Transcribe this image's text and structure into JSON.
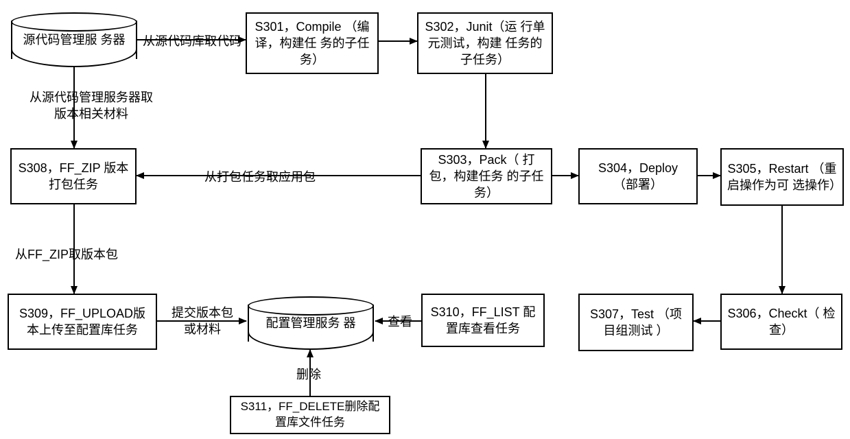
{
  "nodes": {
    "db_source": {
      "label": "源代码管理服\n务器"
    },
    "s301": {
      "label": "S301，Compile\n（编译，构建任\n务的子任务）"
    },
    "s302": {
      "label": "S302，Junit（运\n行单元测试，构建\n任务的子任务）"
    },
    "s303": {
      "label": "S303，Pack（\n打包，构建任务\n的子任务）"
    },
    "s304": {
      "label": "S304，Deploy\n（部署）"
    },
    "s305": {
      "label": "S305，Restart\n（重启操作为可\n选操作）"
    },
    "s306": {
      "label": "S306，Checkt（\n检查）"
    },
    "s307": {
      "label": "S307，Test\n（项目组测试\n）"
    },
    "s308": {
      "label": "S308，FF_ZIP\n版本打包任务"
    },
    "s309": {
      "label": "S309，FF_UPLOAD版\n本上传至配置库任务"
    },
    "s310": {
      "label": "S310，FF_LIST\n配置库查看任务"
    },
    "s311": {
      "label": "S311，FF_DELETE删除配\n置库文件任务"
    },
    "db_config": {
      "label": "配置管理服务\n器"
    }
  },
  "edgeLabels": {
    "l_getcode": "从源代码库取代码",
    "l_getmat": "从源代码管理服务器取\n版本相关材料",
    "l_getpack": "从打包任务取应用包",
    "l_getzip": "从FF_ZIP取版本包",
    "l_submit": "提交版本包\n或材料",
    "l_view": "查看",
    "l_delete": "删除"
  }
}
